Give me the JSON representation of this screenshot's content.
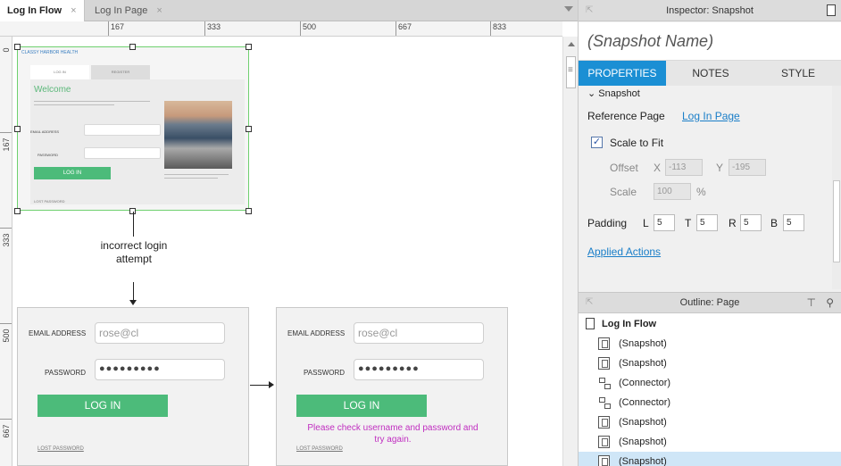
{
  "tabs": [
    {
      "label": "Log In Flow",
      "close": "×"
    },
    {
      "label": "Log In Page",
      "close": "×"
    }
  ],
  "ruler": {
    "h_marks": [
      "167",
      "333",
      "500",
      "667",
      "833"
    ],
    "v_marks": [
      "0",
      "167",
      "333",
      "500",
      "667"
    ]
  },
  "snapshot1": {
    "logo_text": "CLASSY HARBOR HEALTH",
    "tab_login": "LOG IN",
    "tab_register": "REGISTER",
    "welcome": "Welcome",
    "email_label": "EMAIL ADDRESS",
    "password_label": "PASSWORD",
    "login_button": "LOG IN",
    "lost_password": "LOST PASSWORD"
  },
  "connector_label": "incorrect login attempt",
  "snapshot2": {
    "email_label": "EMAIL ADDRESS",
    "email_value": "rose@cl",
    "password_label": "PASSWORD",
    "password_value": "●●●●●●●●●",
    "login_button": "LOG IN",
    "lost_password": "LOST PASSWORD"
  },
  "snapshot3": {
    "email_label": "EMAIL ADDRESS",
    "email_value": "rose@cl",
    "password_label": "PASSWORD",
    "password_value": "●●●●●●●●●",
    "login_button": "LOG IN",
    "error_message": "Please check username and password and try again.",
    "lost_password": "LOST PASSWORD"
  },
  "inspector": {
    "title": "Inspector: Snapshot",
    "snapshot_name_placeholder": "(Snapshot Name)",
    "tabs": [
      "PROPERTIES",
      "NOTES",
      "STYLE"
    ],
    "section": "Snapshot",
    "reference_page_label": "Reference Page",
    "reference_page_link": "Log In Page",
    "scale_to_fit_label": "Scale to Fit",
    "scale_to_fit_checked": true,
    "offset_label": "Offset",
    "offset_x_label": "X",
    "offset_x": "-113",
    "offset_y_label": "Y",
    "offset_y": "-195",
    "scale_label": "Scale",
    "scale_value": "100",
    "scale_unit": "%",
    "padding_label": "Padding",
    "padding": {
      "L": "5",
      "T": "5",
      "R": "5",
      "B": "5"
    },
    "padding_keys": {
      "L": "L",
      "T": "T",
      "R": "R",
      "B": "B"
    },
    "applied_actions": "Applied Actions"
  },
  "outline": {
    "title": "Outline: Page",
    "root": "Log In Flow",
    "items": [
      "(Snapshot)",
      "(Snapshot)",
      "(Connector)",
      "(Connector)",
      "(Snapshot)",
      "(Snapshot)",
      "(Snapshot)"
    ]
  },
  "colors": {
    "accent_blue": "#1b8fd4",
    "button_green": "#4cbb7a",
    "error_magenta": "#c02ec0",
    "selection_green": "#6fd06f"
  }
}
